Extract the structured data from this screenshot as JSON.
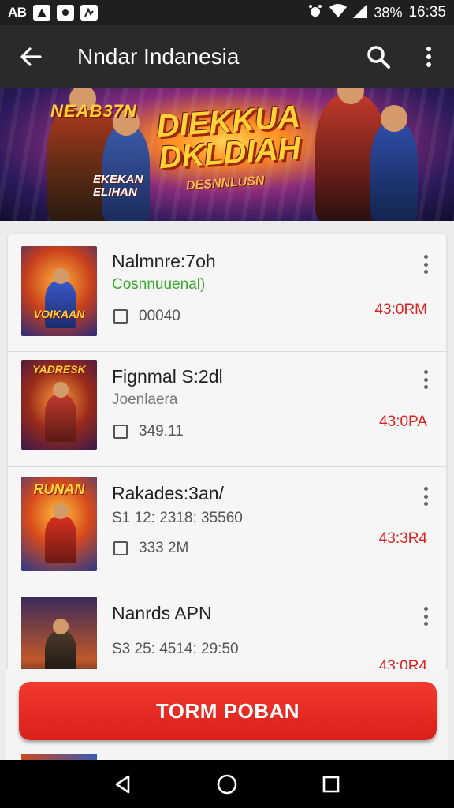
{
  "status_bar": {
    "carrier_label": "AB",
    "battery": "38%",
    "time": "16:35"
  },
  "app_bar": {
    "title": "Nndar Indanesia"
  },
  "banner": {
    "corner_text": "NEAB37N",
    "title_line1": "DIEKKUA",
    "title_line2": "DKLDIAH",
    "sub_text": "DESNNLUSN",
    "side_text_line1": "EKEKAN",
    "side_text_line2": "ELIHAN"
  },
  "items": [
    {
      "title": "Nalmnre:7oh",
      "subtitle": "Cosnnuuenal)",
      "subtitle_color": "#3aa82a",
      "count": "00040",
      "time": "43:0RM",
      "thumb_label": "VOIKAAN"
    },
    {
      "title": "Fignmal S:2dl",
      "subtitle": "Joenlaera",
      "subtitle_color": "#777777",
      "count": "349.11",
      "time": "43:0PA",
      "thumb_label": "YADRESK"
    },
    {
      "title": "Rakades:3an/",
      "subtitle": "S1 12: 2318: 35560",
      "subtitle_color": "#555555",
      "count": "333 2M",
      "time": "43:3R4",
      "thumb_label": "RUNAN"
    },
    {
      "title": "Nanrds APN",
      "subtitle": "S3 25: 4514: 29:50",
      "subtitle_color": "#555555",
      "count": "",
      "time": "43:0R4",
      "thumb_label": ""
    }
  ],
  "cta": {
    "label": "TORM POBAN"
  },
  "colors": {
    "accent": "#e0241c",
    "time_red": "#e02020",
    "app_bar": "#2a2a2a"
  }
}
